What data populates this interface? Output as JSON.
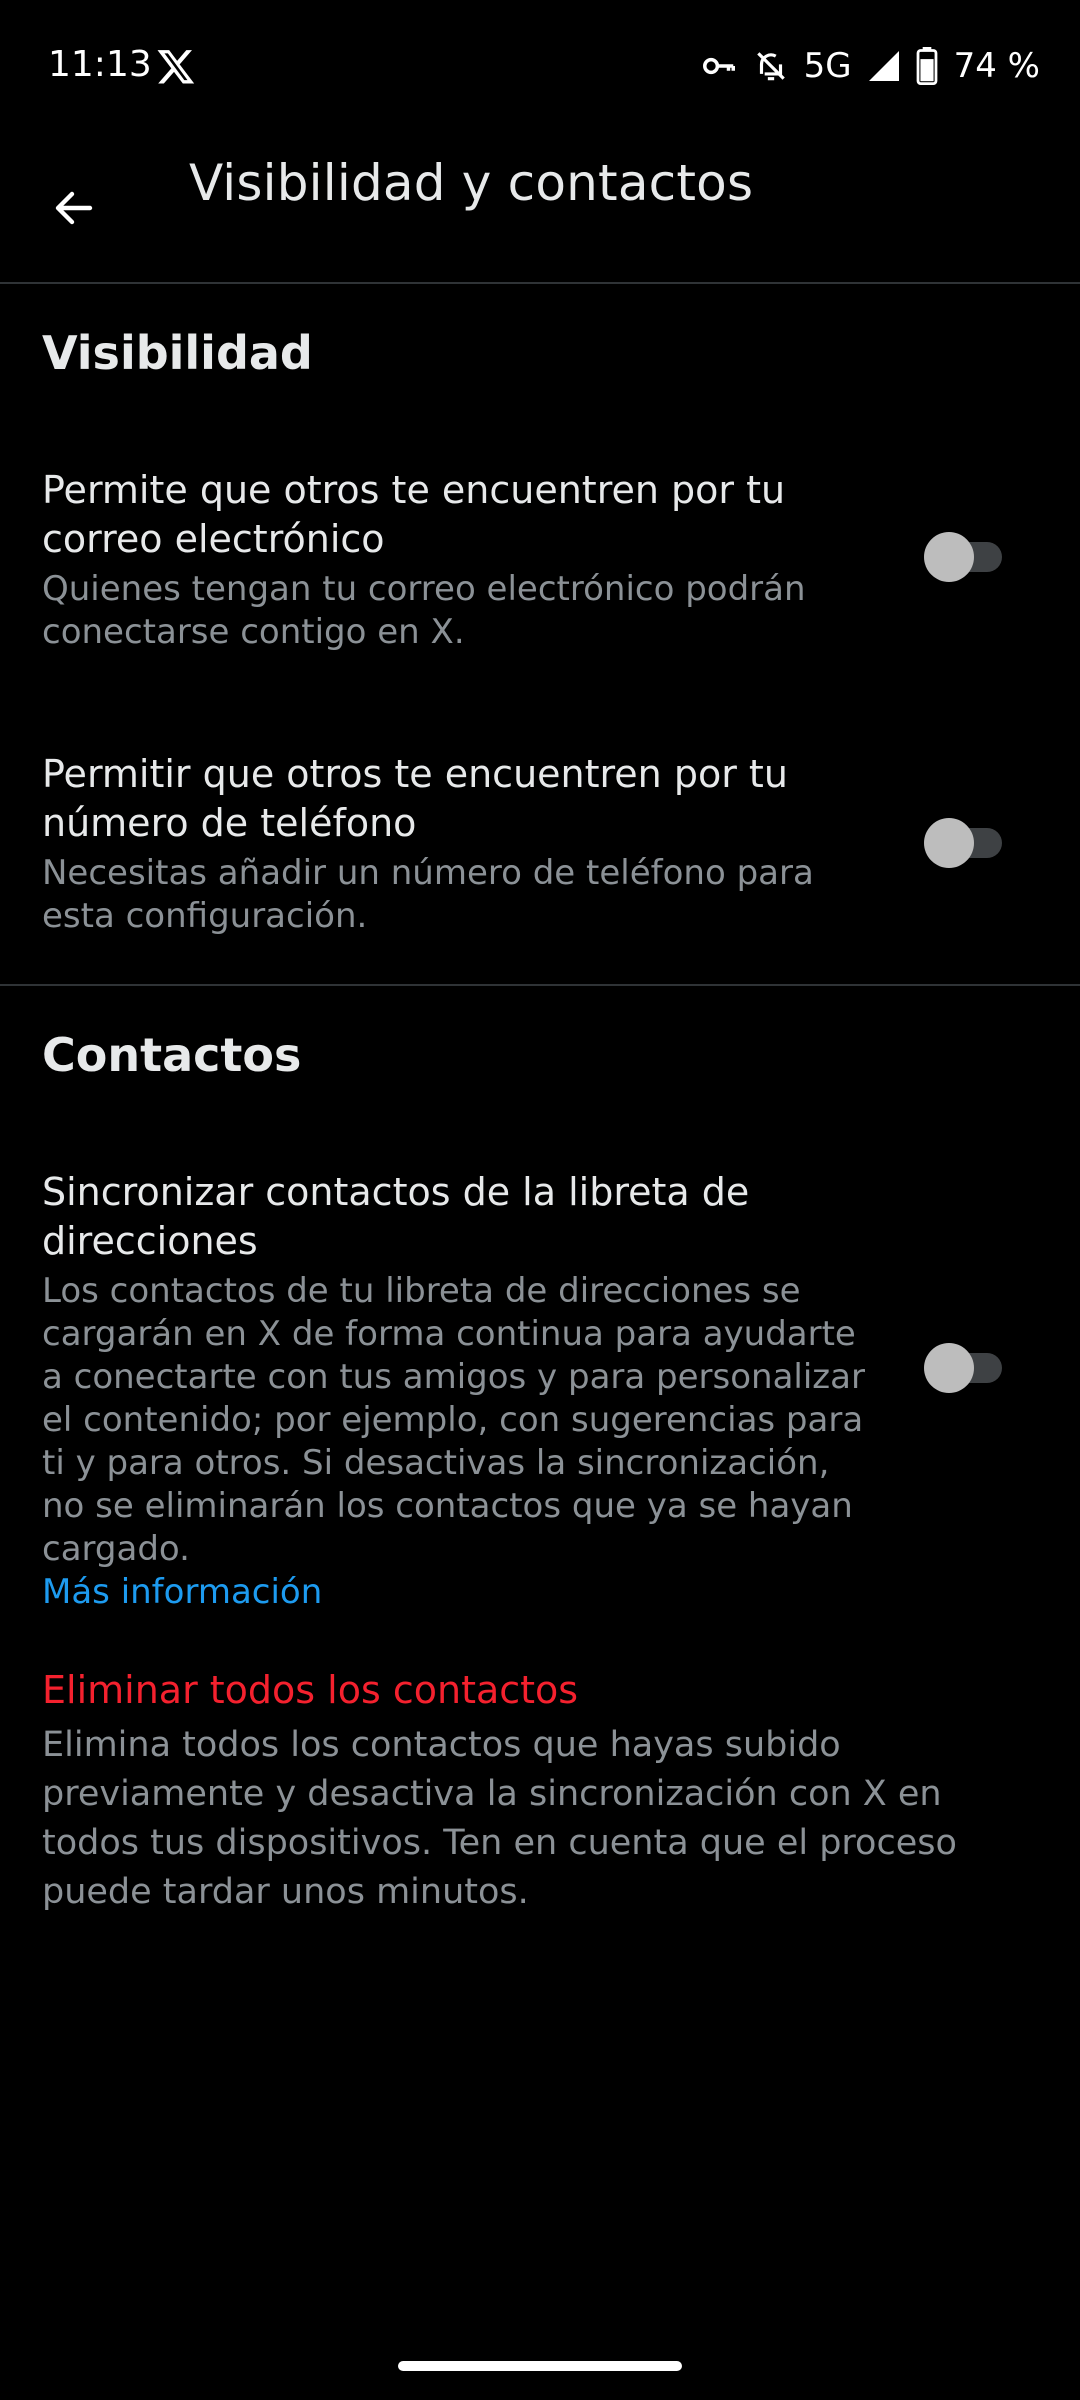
{
  "status_bar": {
    "time": "11:13",
    "network": "5G",
    "battery": "74 %",
    "icons": [
      "x-logo-icon",
      "vpn-key-icon",
      "notifications-off-icon",
      "signal-icon",
      "battery-icon"
    ]
  },
  "header": {
    "title": "Visibilidad y contactos",
    "back_icon": "arrow-left-icon"
  },
  "visibility": {
    "heading": "Visibilidad",
    "email": {
      "title": "Permite que otros te encuentren por tu correo electrónico",
      "description": "Quienes tengan tu correo electrónico podrán conectarse contigo en X.",
      "enabled": false
    },
    "phone": {
      "title": "Permitir que otros te encuentren por tu número de teléfono",
      "description": "Necesitas añadir un número de teléfono para esta configuración.",
      "enabled": false
    }
  },
  "contacts": {
    "heading": "Contactos",
    "sync": {
      "title": "Sincronizar contactos de la libreta de direcciones",
      "description": "Los contactos de tu libreta de direcciones se cargarán en X de forma continua para ayudarte a conectarte con tus amigos y para personalizar el contenido; por ejemplo, con sugerencias para ti y para otros. Si desactivas la sincronización, no se eliminarán los contactos que ya se hayan cargado.",
      "link": "Más información",
      "enabled": false
    },
    "delete": {
      "title": "Eliminar todos los contactos",
      "description": "Elimina todos los contactos que hayas subido previamente y desactiva la sincronización con X en todos tus dispositivos. Ten en cuenta que el proceso puede tardar unos minutos."
    }
  },
  "colors": {
    "background": "#000000",
    "primary_text": "#e7e9ea",
    "secondary_text": "#8b9196",
    "link": "#1d9bf0",
    "danger": "#f4212e",
    "divider": "#2f3336"
  }
}
